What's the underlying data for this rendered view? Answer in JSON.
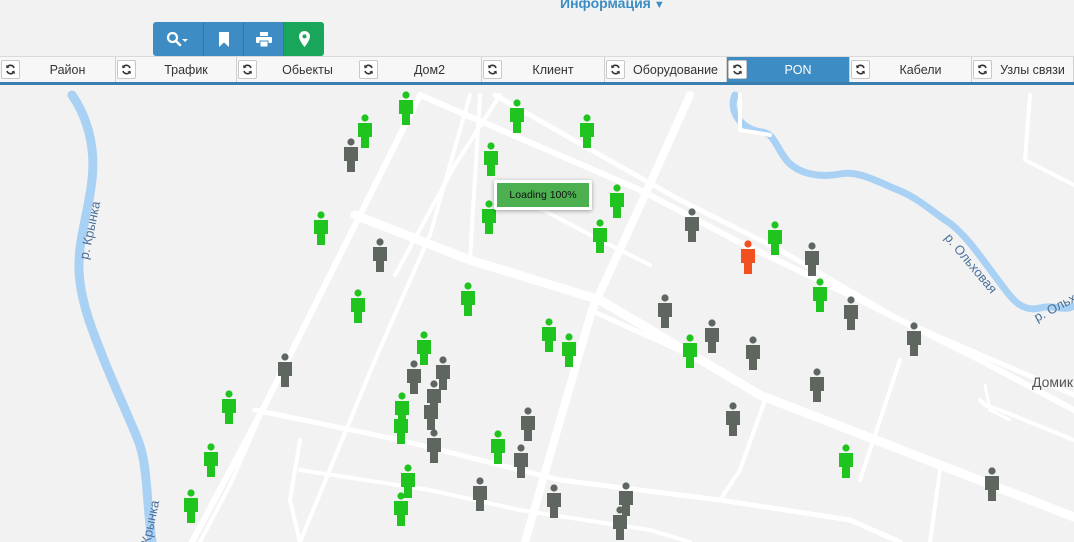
{
  "header": {
    "info_menu_label": "Информация"
  },
  "toolbar": {
    "buttons": [
      {
        "name": "search",
        "icon": "search-icon"
      },
      {
        "name": "bookmark",
        "icon": "bookmark-icon"
      },
      {
        "name": "print",
        "icon": "print-icon"
      },
      {
        "name": "map",
        "icon": "map-marker-icon"
      }
    ],
    "accent": "#3d8cc3",
    "map_button_color": "#19a65a"
  },
  "tabs": [
    {
      "label": "Район",
      "active": false
    },
    {
      "label": "Трафик",
      "active": false
    },
    {
      "label": "Обьекты",
      "active": false
    },
    {
      "label": "Дом2",
      "active": false
    },
    {
      "label": "Клиент",
      "active": false
    },
    {
      "label": "Оборудование",
      "active": false
    },
    {
      "label": "PON",
      "active": true
    },
    {
      "label": "Кабели",
      "active": false
    },
    {
      "label": "Узлы связи",
      "active": false
    }
  ],
  "loading": {
    "text": "Loading 100%"
  },
  "map": {
    "river_labels": [
      "р. Крынка",
      "Крынка",
      "р. Ольховая",
      "р. Ольх"
    ],
    "place_label": "Домик",
    "marker_colors": {
      "online": "#1fc41f",
      "offline": "#5f6660",
      "alarm": "#f0511e"
    }
  }
}
